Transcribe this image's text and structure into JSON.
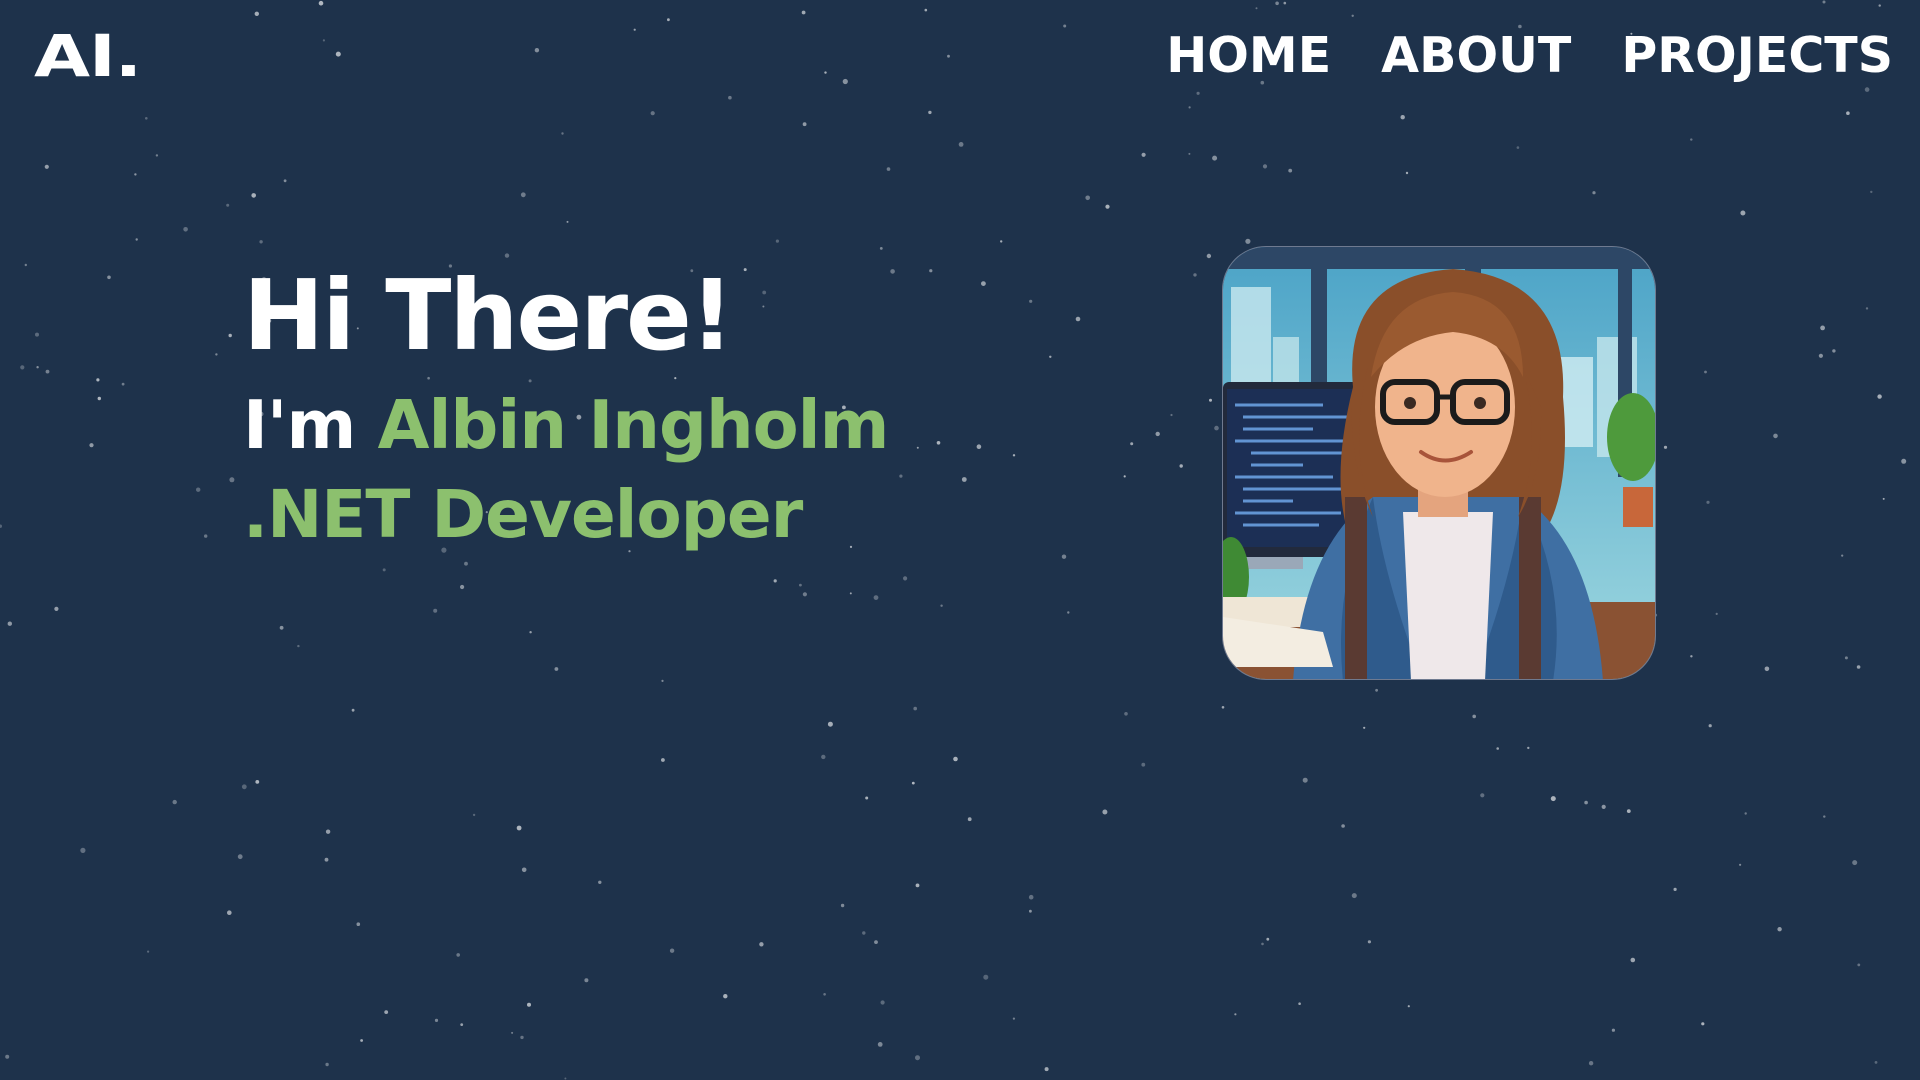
{
  "brand": {
    "logo_text": "AI."
  },
  "nav": {
    "items": [
      {
        "label": "HOME"
      },
      {
        "label": "ABOUT"
      },
      {
        "label": "PROJECTS"
      }
    ]
  },
  "hero": {
    "greeting": "Hi There!",
    "intro_prefix": "I'm ",
    "name": "Albin Ingholm",
    "role": ".NET Developer"
  },
  "colors": {
    "background": "#1e324b",
    "text": "#ffffff",
    "accent": "#8cc06e"
  },
  "portrait": {
    "icon": "avatar-illustration"
  }
}
